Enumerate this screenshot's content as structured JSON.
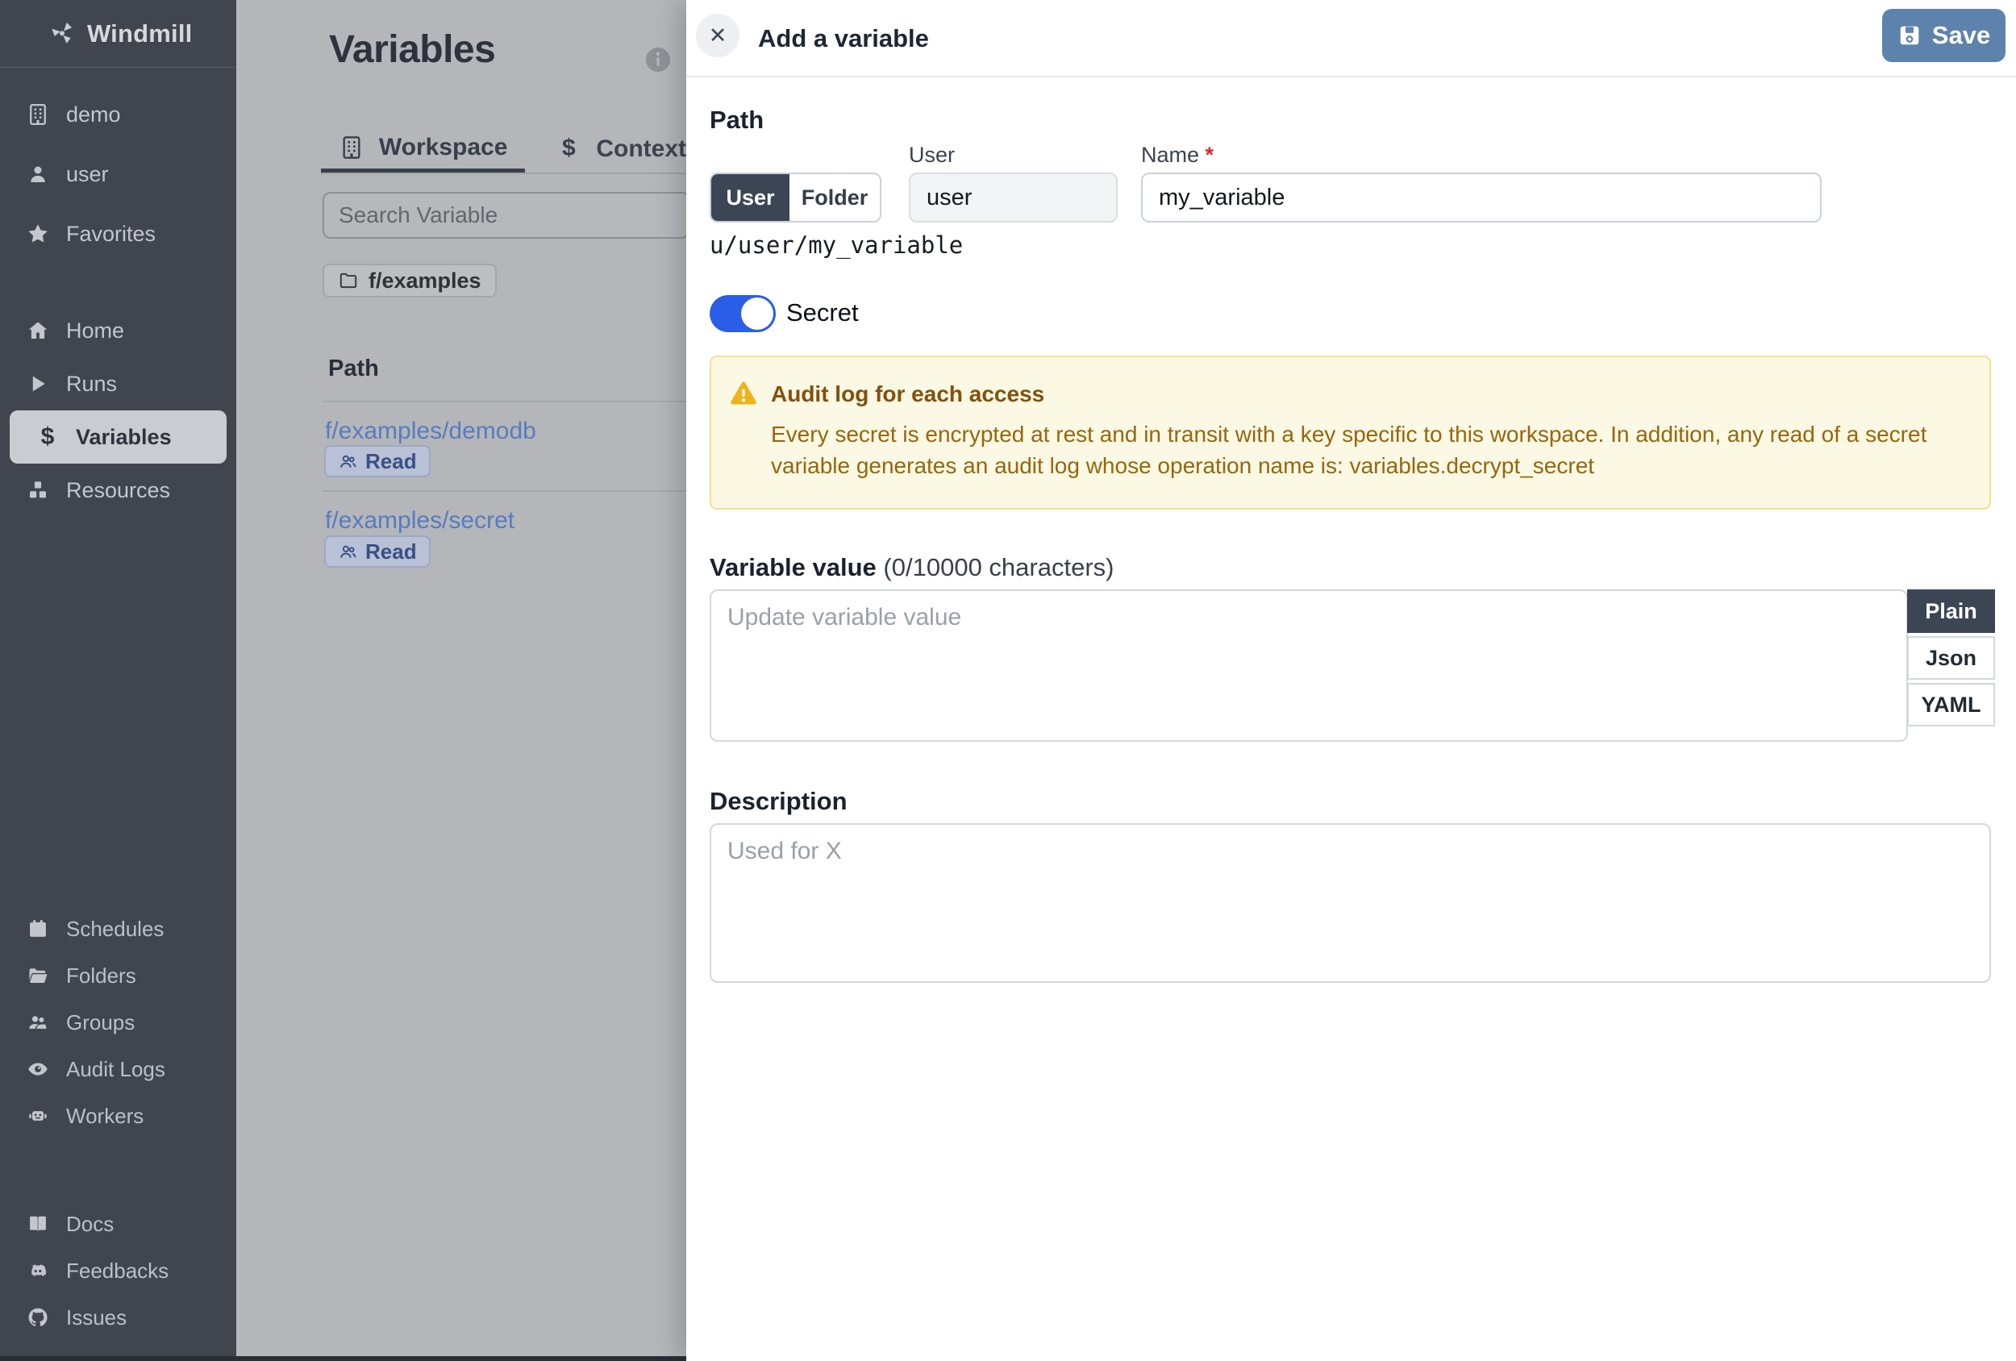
{
  "brand": {
    "name": "Windmill"
  },
  "sidebar": {
    "workspace": [
      {
        "label": "demo"
      },
      {
        "label": "user"
      },
      {
        "label": "Favorites"
      }
    ],
    "nav": [
      {
        "label": "Home"
      },
      {
        "label": "Runs"
      },
      {
        "label": "Variables"
      },
      {
        "label": "Resources"
      }
    ],
    "admin": [
      {
        "label": "Schedules"
      },
      {
        "label": "Folders"
      },
      {
        "label": "Groups"
      },
      {
        "label": "Audit Logs"
      },
      {
        "label": "Workers"
      }
    ],
    "footer": [
      {
        "label": "Docs"
      },
      {
        "label": "Feedbacks"
      },
      {
        "label": "Issues"
      }
    ]
  },
  "main": {
    "title": "Variables",
    "tabs": [
      {
        "label": "Workspace"
      },
      {
        "label": "Context"
      }
    ],
    "search_placeholder": "Search Variable",
    "folder_chip": "f/examples",
    "table": {
      "path_header": "Path",
      "rows": [
        {
          "path": "f/examples/demodb",
          "badge": "Read"
        },
        {
          "path": "f/examples/secret",
          "badge": "Read"
        }
      ]
    }
  },
  "drawer": {
    "title": "Add a variable",
    "save_label": "Save",
    "path_section": {
      "heading": "Path",
      "owner_toggle": {
        "user": "User",
        "folder": "Folder",
        "selected": "User"
      },
      "user_label": "User",
      "user_value": "user",
      "name_label": "Name",
      "name_required_mark": "*",
      "name_value": "my_variable",
      "full_path": "u/user/my_variable"
    },
    "secret": {
      "label": "Secret",
      "enabled": true
    },
    "warning": {
      "title": "Audit log for each access",
      "body": "Every secret is encrypted at rest and in transit with a key specific to this workspace. In addition, any read of a secret variable generates an audit log whose operation name is: variables.decrypt_secret"
    },
    "value_section": {
      "heading": "Variable value",
      "counter": " (0/10000 characters)",
      "placeholder": "Update variable value",
      "format_tabs": [
        {
          "label": "Plain"
        },
        {
          "label": "Json"
        },
        {
          "label": "YAML"
        }
      ]
    },
    "description_section": {
      "heading": "Description",
      "placeholder": "Used for X"
    }
  },
  "colors": {
    "sidebar_bg": "#41454e",
    "accent_blue": "#2b5ee8",
    "save_blue": "#5d83ad",
    "dark_slate": "#3b4554",
    "warning_bg": "#fbf8e4",
    "warning_border": "#efe193",
    "link_blue": "#567cc0"
  }
}
